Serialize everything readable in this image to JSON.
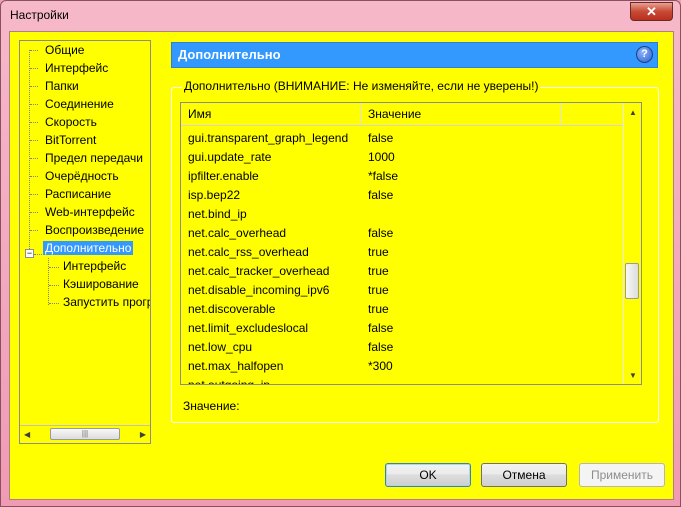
{
  "window": {
    "title": "Настройки",
    "close_label": "✕"
  },
  "tree": {
    "items": [
      {
        "label": "Общие"
      },
      {
        "label": "Интерфейс"
      },
      {
        "label": "Папки"
      },
      {
        "label": "Соединение"
      },
      {
        "label": "Скорость"
      },
      {
        "label": "BitTorrent"
      },
      {
        "label": "Предел передачи"
      },
      {
        "label": "Очерёдность"
      },
      {
        "label": "Расписание"
      },
      {
        "label": "Web-интерфейс"
      },
      {
        "label": "Воспроизведение"
      },
      {
        "label": "Дополнительно"
      }
    ],
    "children": [
      {
        "label": "Интерфейс"
      },
      {
        "label": "Кэширование"
      },
      {
        "label": "Запустить прогр"
      }
    ],
    "expander": "−"
  },
  "header": {
    "title": "Дополнительно",
    "help": "?"
  },
  "group": {
    "title": "Дополнительно (ВНИМАНИЕ: Не изменяйте, если не уверены!)"
  },
  "list": {
    "columns": [
      "Имя",
      "Значение"
    ],
    "rows": [
      {
        "name": "gui.transparent_graph_legend",
        "value": "false"
      },
      {
        "name": "gui.update_rate",
        "value": "1000"
      },
      {
        "name": "ipfilter.enable",
        "value": "*false"
      },
      {
        "name": "isp.bep22",
        "value": "false"
      },
      {
        "name": "net.bind_ip",
        "value": ""
      },
      {
        "name": "net.calc_overhead",
        "value": "false"
      },
      {
        "name": "net.calc_rss_overhead",
        "value": "true"
      },
      {
        "name": "net.calc_tracker_overhead",
        "value": "true"
      },
      {
        "name": "net.disable_incoming_ipv6",
        "value": "true"
      },
      {
        "name": "net.discoverable",
        "value": "true"
      },
      {
        "name": "net.limit_excludeslocal",
        "value": "false"
      },
      {
        "name": "net.low_cpu",
        "value": "false"
      },
      {
        "name": "net.max_halfopen",
        "value": "*300"
      },
      {
        "name": "net.outgoing_ip",
        "value": ""
      }
    ]
  },
  "value_label": "Значение:",
  "buttons": {
    "ok": "OK",
    "cancel": "Отмена",
    "apply": "Применить"
  },
  "colors": {
    "background": "#ffff00",
    "accent": "#3399ff",
    "titlebar": "#f0a0b8"
  }
}
